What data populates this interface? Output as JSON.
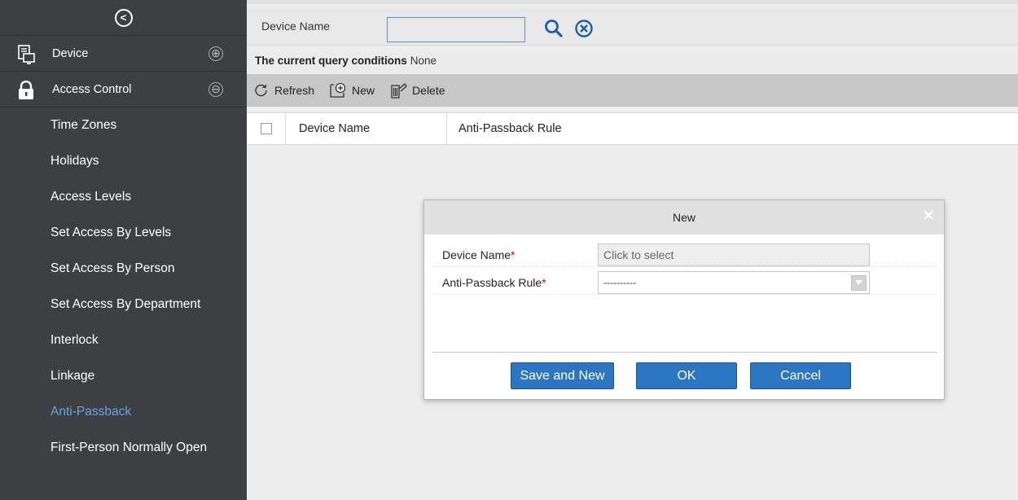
{
  "sidebar": {
    "collapse_icon": "chevron-left-circle-icon",
    "menus": [
      {
        "label": "Device",
        "icon": "device-icon",
        "toggle": "⊕"
      },
      {
        "label": "Access Control",
        "icon": "lock-icon",
        "toggle": "⊖"
      }
    ],
    "items": [
      {
        "label": "Time Zones"
      },
      {
        "label": "Holidays"
      },
      {
        "label": "Access Levels"
      },
      {
        "label": "Set Access By Levels"
      },
      {
        "label": "Set Access By Person"
      },
      {
        "label": "Set Access By Department"
      },
      {
        "label": "Interlock"
      },
      {
        "label": "Linkage"
      },
      {
        "label": "Anti-Passback"
      },
      {
        "label": "First-Person Normally Open"
      }
    ],
    "active_item": "Anti-Passback",
    "active_color": "#6aa2e4"
  },
  "query": {
    "label": "Device Name",
    "value": ""
  },
  "conditions": {
    "label": "The current query conditions",
    "value": "None"
  },
  "toolbar": {
    "refresh_label": "Refresh",
    "new_label": "New",
    "delete_label": "Delete"
  },
  "grid": {
    "columns": [
      "Device Name",
      "Anti-Passback Rule"
    ],
    "rows": []
  },
  "dialog": {
    "title": "New",
    "fields": [
      {
        "label": "Device Name",
        "required": "*",
        "placeholder": "Click to select"
      },
      {
        "label": "Anti-Passback Rule",
        "required": "*",
        "value": "----------"
      }
    ],
    "buttons": {
      "save_new": "Save and New",
      "ok": "OK",
      "cancel": "Cancel"
    }
  },
  "colors": {
    "sidebar_bg": "#3c4043",
    "button_blue": "#2b75c2",
    "required": "#dd0000"
  }
}
